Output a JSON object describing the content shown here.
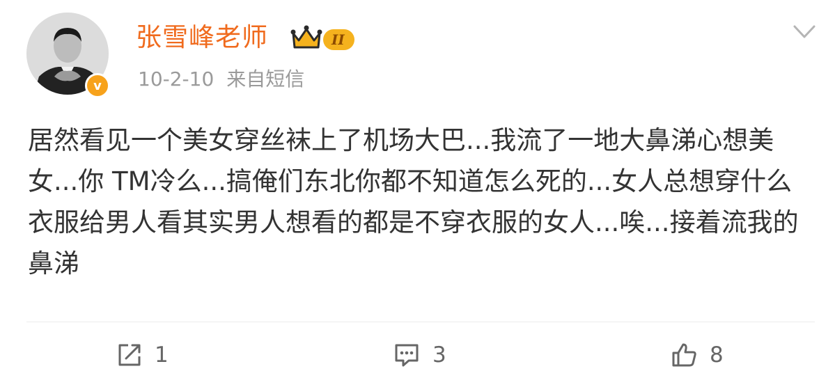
{
  "post": {
    "author": {
      "name": "张雪峰老师",
      "level_badge": "II",
      "verified_mark": "v",
      "avatar_icon": "avatar-icon"
    },
    "date": "10-2-10",
    "source": "来自短信",
    "text": "居然看见一个美女穿丝袜上了机场大巴...我流了一地大鼻涕心想美女...你 TM冷么...搞俺们东北你都不知道怎么死的...女人总想穿什么衣服给男人看其实男人想看的都是不穿衣服的女人...唉...接着流我的鼻涕"
  },
  "actions": {
    "repost_count": "1",
    "comment_count": "3",
    "like_count": "8"
  },
  "colors": {
    "username": "#f06b1e",
    "badge": "#f5b21e",
    "verified": "#f7a21b",
    "meta_text": "#9a9a9a"
  }
}
